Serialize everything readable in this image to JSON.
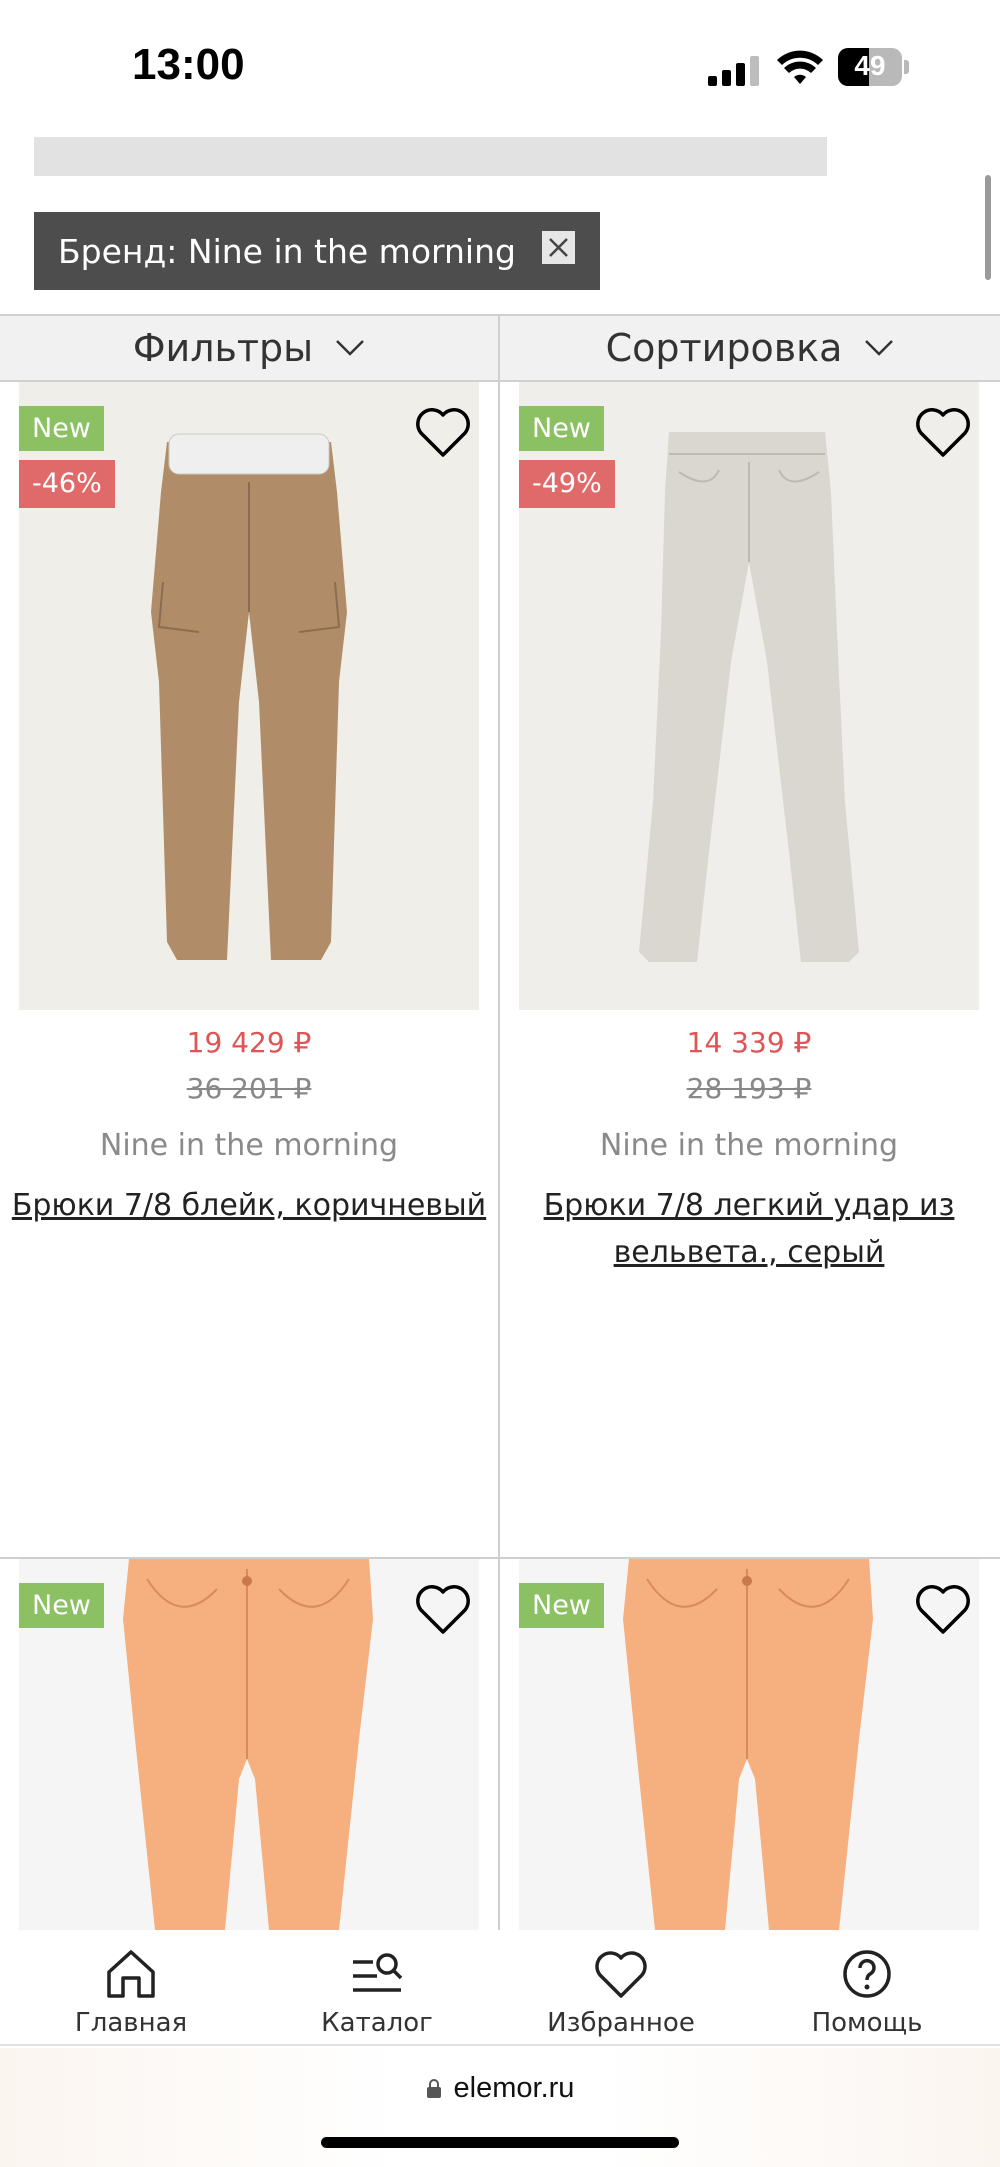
{
  "status_bar": {
    "time": "13:00",
    "battery": "49",
    "battery_level": 0.49
  },
  "filter_chip": {
    "label": "Бренд: Nine in the morning",
    "close_icon": "close-icon"
  },
  "controls": {
    "filters_label": "Фильтры",
    "sort_label": "Сортировка"
  },
  "products": [
    {
      "badge_new": "New",
      "badge_discount": "-46%",
      "price": "19 429 ₽",
      "old_price": "36 201 ₽",
      "brand": "Nine in the morning",
      "title": "Брюки 7/8 блейк, коричневый",
      "image_bg": "#f0eee9",
      "garment_color": "#b08d68"
    },
    {
      "badge_new": "New",
      "badge_discount": "-49%",
      "price": "14 339 ₽",
      "old_price": "28 193 ₽",
      "brand": "Nine in the morning",
      "title": "Брюки 7/8 легкий удар из вельвета., серый",
      "image_bg": "#efeeea",
      "garment_color": "#d9d7cf"
    },
    {
      "badge_new": "New",
      "image_bg": "#f5f5f5",
      "garment_color": "#f6b080"
    },
    {
      "badge_new": "New",
      "image_bg": "#f5f5f5",
      "garment_color": "#f6b080"
    }
  ],
  "bottom_nav": [
    {
      "label": "Главная",
      "icon": "home-icon"
    },
    {
      "label": "Каталог",
      "icon": "catalog-search-icon"
    },
    {
      "label": "Избранное",
      "icon": "heart-icon"
    },
    {
      "label": "Помощь",
      "icon": "help-icon"
    }
  ],
  "browser": {
    "url": "elemor.ru"
  },
  "colors": {
    "price_red": "#e05454",
    "badge_green": "#8bc063",
    "badge_red": "#e06a6a",
    "chip_dark": "#4d4d4d"
  }
}
